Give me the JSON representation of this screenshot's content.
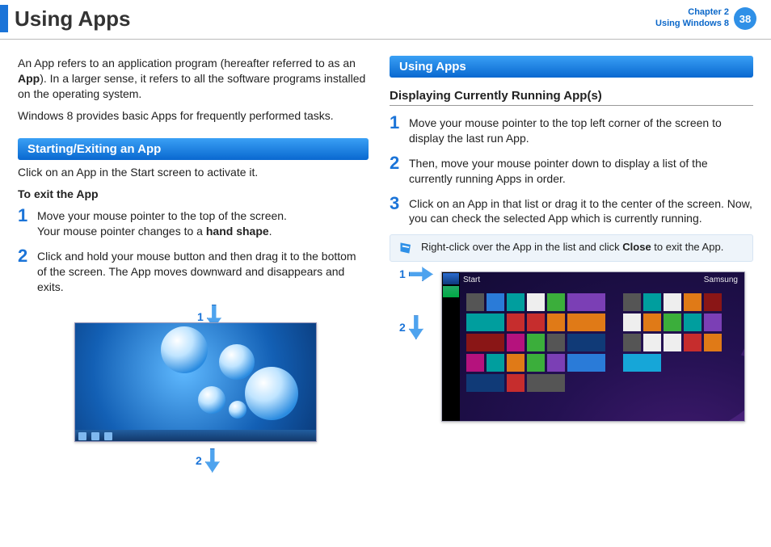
{
  "header": {
    "title": "Using Apps",
    "chapter_line1": "Chapter 2",
    "chapter_line2": "Using Windows 8",
    "page_number": "38"
  },
  "left": {
    "intro_p1a": "An App refers to an application program (hereafter referred to as an ",
    "intro_p1b": "App",
    "intro_p1c": "). In a larger sense, it refers to all the software programs installed on the operating system.",
    "intro_p2": "Windows 8 provides basic Apps for frequently performed tasks.",
    "section_title": "Starting/Exiting an App",
    "section_sub": "Click on an App in the Start screen to activate it.",
    "exit_title": "To exit the App",
    "step1_a": " Move your mouse pointer to the top of the screen.",
    "step1_b": "Your mouse pointer changes to a ",
    "step1_bold": "hand shape",
    "step1_c": ".",
    "step2": "Click and hold your mouse button and then drag it to the bottom of the screen. The App moves downward and disappears and exits.",
    "callout1": "1",
    "callout2": "2"
  },
  "right": {
    "section_title": "Using Apps",
    "sub_heading": "Displaying Currently Running App(s)",
    "step1": "Move your mouse pointer to the top left corner of the screen to display the last run App.",
    "step2": "Then, move your mouse pointer down to display a list of the currently running Apps in order.",
    "step3": "Click on an App in that list or drag it to the center of the screen. Now, you can check the selected App which is currently running.",
    "tip_a": "Right-click over the App in the list and click  ",
    "tip_bold": "Close",
    "tip_b": " to exit the App.",
    "callout1": "1",
    "callout2": "2",
    "start_label": "Start",
    "user_label": "Samsung"
  },
  "nums": {
    "n1": "1",
    "n2": "2",
    "n3": "3"
  }
}
